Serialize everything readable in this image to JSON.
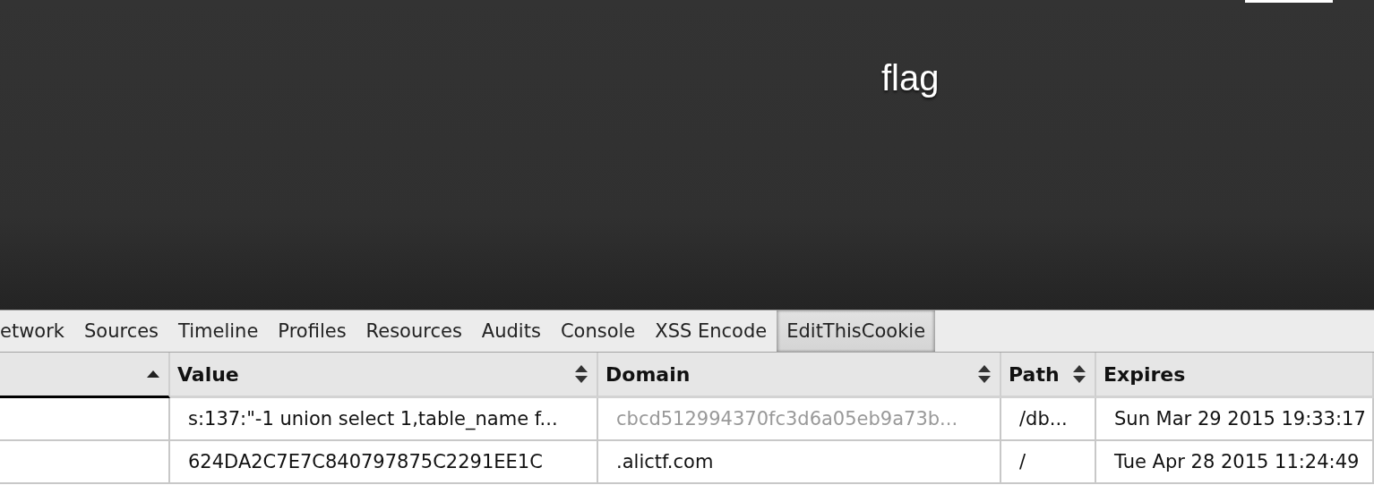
{
  "page": {
    "heading": "flag"
  },
  "devtools": {
    "tabs": [
      {
        "label": "etwork",
        "selected": false
      },
      {
        "label": "Sources",
        "selected": false
      },
      {
        "label": "Timeline",
        "selected": false
      },
      {
        "label": "Profiles",
        "selected": false
      },
      {
        "label": "Resources",
        "selected": false
      },
      {
        "label": "Audits",
        "selected": false
      },
      {
        "label": "Console",
        "selected": false
      },
      {
        "label": "XSS Encode",
        "selected": false
      },
      {
        "label": "EditThisCookie",
        "selected": true
      }
    ]
  },
  "table": {
    "columns": [
      {
        "sorted": true,
        "sortable": true
      },
      {
        "label": "Value",
        "sorted": false,
        "sortable": true
      },
      {
        "label": "Domain",
        "sorted": false,
        "sortable": true
      },
      {
        "label": "Path",
        "sorted": false,
        "sortable": true
      },
      {
        "label": "Expires",
        "sorted": false,
        "sortable": false
      }
    ],
    "rows": [
      {
        "cells": [
          {},
          {
            "text": "s:137:\"-1 union select 1,table_name f...",
            "dimmed": false
          },
          {
            "text": "cbcd512994370fc3d6a05eb9a73b...",
            "dimmed": true
          },
          {
            "text": "/db...",
            "dimmed": false
          },
          {
            "text": "Sun Mar 29 2015 19:33:17",
            "dimmed": false
          }
        ]
      },
      {
        "cells": [
          {},
          {
            "text": "624DA2C7E7C840797875C2291EE1C",
            "dimmed": false
          },
          {
            "text": ".alictf.com",
            "dimmed": false
          },
          {
            "text": "/",
            "dimmed": false
          },
          {
            "text": "Tue Apr 28 2015 11:24:49",
            "dimmed": false
          }
        ]
      }
    ]
  }
}
